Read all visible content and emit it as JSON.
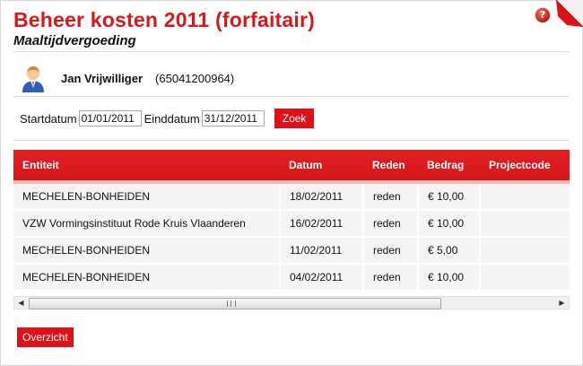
{
  "header": {
    "title": "Beheer kosten 2011 (forfaitair)",
    "subtitle": "Maaltijdvergoeding",
    "help_glyph": "?"
  },
  "user": {
    "name": "Jan Vrijwilliger",
    "id": "(65041200964)",
    "icon": "user-avatar-icon"
  },
  "filter": {
    "start_label": "Startdatum",
    "start_value": "01/01/2011",
    "end_label": "Einddatum",
    "end_value": "31/12/2011",
    "search_label": "Zoek"
  },
  "table": {
    "headers": [
      "Entiteit",
      "Datum",
      "Reden",
      "Bedrag",
      "Projectcode"
    ],
    "rows": [
      [
        "MECHELEN-BONHEIDEN",
        "18/02/2011",
        "reden",
        "€ 10,00",
        ""
      ],
      [
        "VZW Vormingsinstituut Rode Kruis Vlaanderen",
        "16/02/2011",
        "reden",
        "€ 10,00",
        ""
      ],
      [
        "MECHELEN-BONHEIDEN",
        "11/02/2011",
        "reden",
        "€ 5,00",
        ""
      ],
      [
        "MECHELEN-BONHEIDEN",
        "04/02/2011",
        "reden",
        "€ 10,00",
        ""
      ]
    ]
  },
  "footer": {
    "overview_label": "Overzicht"
  },
  "colors": {
    "accent": "#e0101a",
    "title": "#d61a1a"
  }
}
